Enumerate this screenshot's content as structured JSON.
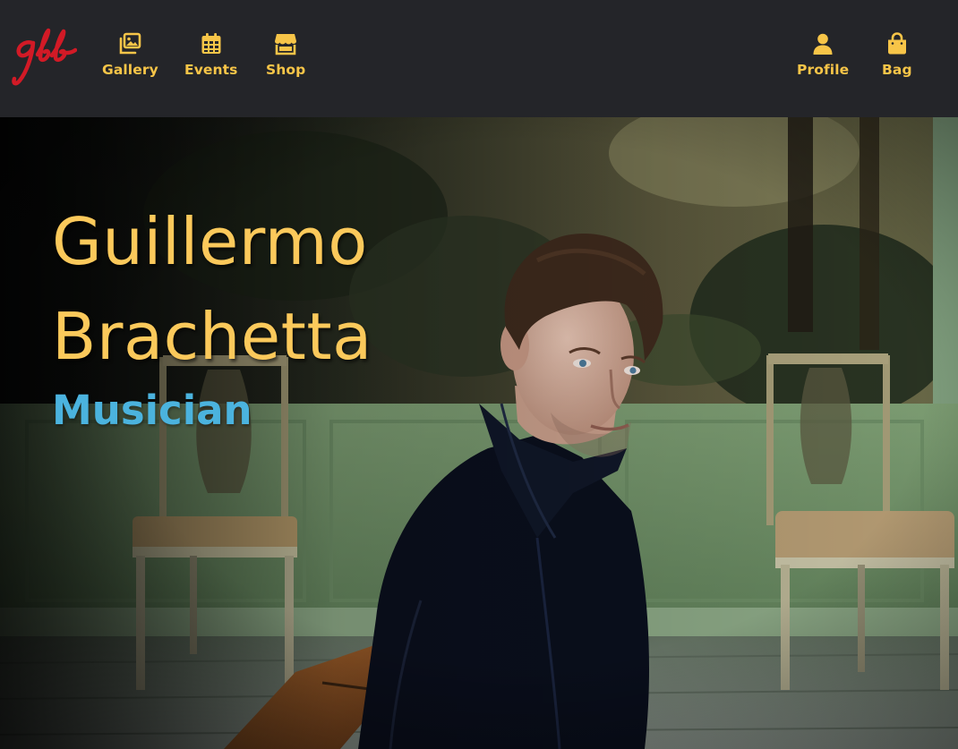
{
  "brand": {
    "logo_text": "gb",
    "logo_color": "#d21a26"
  },
  "nav": {
    "left": [
      {
        "label": "Gallery",
        "icon": "gallery-icon"
      },
      {
        "label": "Events",
        "icon": "calendar-icon"
      },
      {
        "label": "Shop",
        "icon": "store-icon"
      }
    ],
    "right": [
      {
        "label": "Profile",
        "icon": "user-icon"
      },
      {
        "label": "Bag",
        "icon": "shopping-bag-icon"
      }
    ]
  },
  "hero": {
    "name_line1": "Guillermo",
    "name_line2": "Brachetta",
    "role": "Musician"
  },
  "colors": {
    "nav_bg": "#242529",
    "accent_yellow": "#f7c548",
    "name_yellow": "#fbc95b",
    "role_blue": "#4bb3de"
  }
}
